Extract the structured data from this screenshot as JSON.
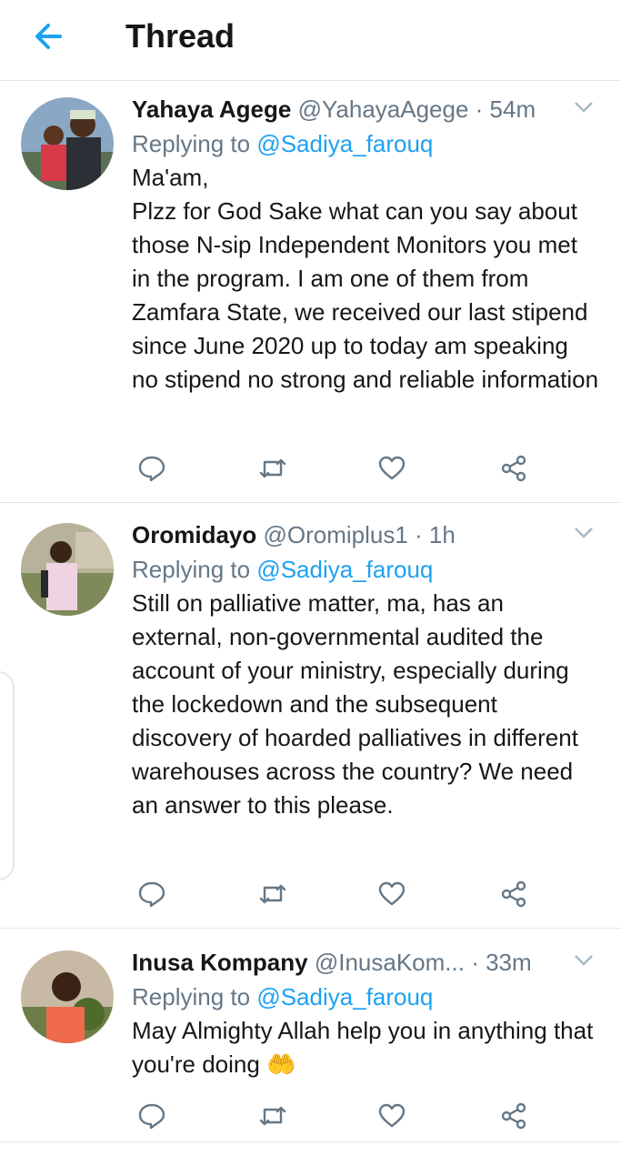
{
  "header": {
    "title": "Thread",
    "back_icon": "arrow-left-icon",
    "accent": "#1da1f2"
  },
  "tweets": [
    {
      "name": "Yahaya Agege",
      "handle": "@YahayaAgege",
      "sep": " · ",
      "time": "54m",
      "replying_label": "Replying to ",
      "replying_to": "@Sadiya_farouq",
      "text": "Ma'am,\nPlzz for God Sake what can you say about those N-sip Independent Monitors you met in the program. I am one of them from Zamfara State, we received our last stipend since June 2020 up to today am speaking no stipend no strong and reliable information"
    },
    {
      "name": "Oromidayo",
      "handle": "@Oromiplus1",
      "sep": " · ",
      "time": "1h",
      "replying_label": "Replying to ",
      "replying_to": "@Sadiya_farouq",
      "text": "Still on palliative matter, ma, has an external, non-governmental audited the account of your ministry, especially during the lockedown and the subsequent discovery of hoarded palliatives in different warehouses across the country? We need an answer to this please."
    },
    {
      "name": "Inusa Kompany",
      "handle": "@InusaKom...",
      "sep": " · ",
      "time": "33m",
      "replying_label": "Replying to ",
      "replying_to": "@Sadiya_farouq",
      "text": "May Almighty Allah help you in anything that you're doing ",
      "emoji": "🤲"
    }
  ],
  "action_icons": [
    "reply-icon",
    "retweet-icon",
    "like-icon",
    "share-icon"
  ],
  "colors": {
    "text": "#14171a",
    "muted": "#657786",
    "divider": "#e1e8ed",
    "link": "#1da1f2"
  }
}
